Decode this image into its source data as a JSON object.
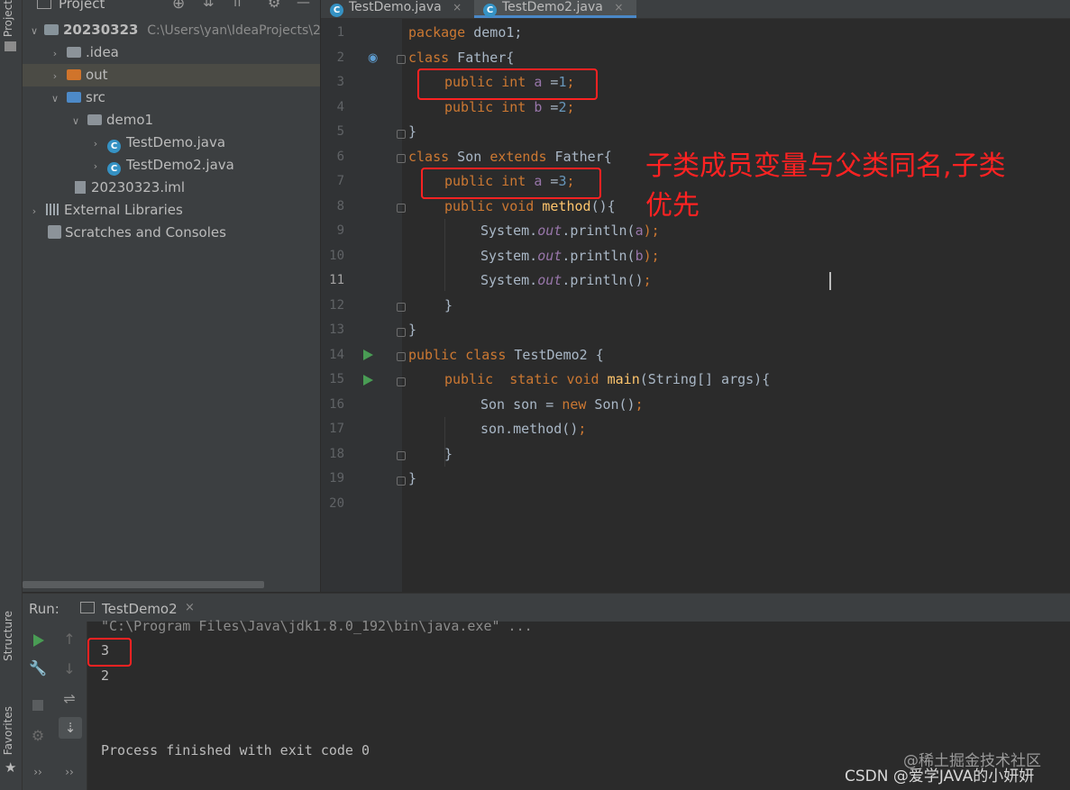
{
  "left_stripe": {
    "top_tab": "Project",
    "structure_tab": "Structure",
    "favorites_tab": "Favorites"
  },
  "project": {
    "title": "Project",
    "tree": [
      {
        "label": "20230323",
        "path": "C:\\Users\\yan\\IdeaProjects\\2"
      },
      {
        "label": ".idea"
      },
      {
        "label": "out"
      },
      {
        "label": "src"
      },
      {
        "label": "demo1"
      },
      {
        "label": "TestDemo.java"
      },
      {
        "label": "TestDemo2.java"
      },
      {
        "label": "20230323.iml"
      },
      {
        "label": "External Libraries"
      },
      {
        "label": "Scratches and Consoles"
      }
    ]
  },
  "editor": {
    "tabs": [
      {
        "label": "TestDemo.java"
      },
      {
        "label": "TestDemo2.java"
      }
    ],
    "line_numbers": [
      "1",
      "2",
      "3",
      "4",
      "5",
      "6",
      "7",
      "8",
      "9",
      "10",
      "11",
      "12",
      "13",
      "14",
      "15",
      "16",
      "17",
      "18",
      "19",
      "20"
    ],
    "code": {
      "l1": {
        "kw": "package",
        "rest": " demo1;"
      },
      "l2": {
        "kw": "class",
        "rest": " Father{"
      },
      "l3": {
        "kw1": "public",
        "kw2": "int",
        "fld": "a",
        "eq": " =",
        "num": "1",
        "end": ";"
      },
      "l4": {
        "kw1": "public",
        "kw2": "int",
        "fld": "b",
        "eq": " =",
        "num": "2",
        "end": ";"
      },
      "l5": "}",
      "l6": {
        "kw1": "class",
        "mid": " Son ",
        "kw2": "extends",
        "rest": " Father{"
      },
      "l7": {
        "kw1": "public",
        "kw2": "int",
        "fld": "a",
        "eq": " =",
        "num": "3",
        "end": ";"
      },
      "l8": {
        "kw1": "public",
        "kw2": "void",
        "mth": "method",
        "rest": "(){"
      },
      "l9": {
        "pre": "System.",
        "out": "out",
        "call": ".println(",
        "arg": "a",
        "end": ");"
      },
      "l10": {
        "pre": "System.",
        "out": "out",
        "call": ".println(",
        "arg": "b",
        "end": ");"
      },
      "l11": {
        "pre": "System.",
        "out": "out",
        "call": ".println()",
        "end": ";"
      },
      "l12": "}",
      "l13": "}",
      "l14": {
        "kw1": "public",
        "kw2": "class",
        "rest": " TestDemo2 {"
      },
      "l15": {
        "kw1": "public",
        "kw2": "static",
        "kw3": "void",
        "mth": "main",
        "rest": "(String[] args){"
      },
      "l16": {
        "pre": "Son son = ",
        "kw": "new",
        "rest": " Son()",
        "end": ";"
      },
      "l17": {
        "pre": "son.method()",
        "end": ";"
      },
      "l18": "}",
      "l19": "}"
    },
    "annotation_line1": "子类成员变量与父类同名,子类",
    "annotation_line2": "优先"
  },
  "run": {
    "label": "Run:",
    "tab": "TestDemo2",
    "console_lines": [
      "\"C:\\Program Files\\Java\\jdk1.8.0_192\\bin\\java.exe\" ...",
      "3",
      "2",
      "Process finished with exit code 0"
    ]
  },
  "watermark": {
    "line1": "@稀土掘金技术社区",
    "line2": "CSDN @爱学JAVA的小妍妍"
  },
  "colors": {
    "keyword": "#cc7832",
    "number": "#6897bb",
    "field": "#9876aa",
    "method": "#ffc66d",
    "annotation": "#ff2222"
  }
}
